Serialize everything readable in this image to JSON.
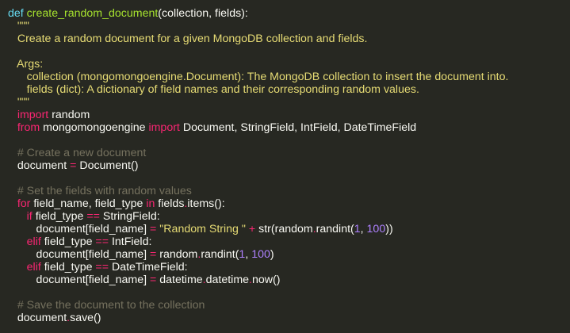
{
  "code": {
    "language": "python",
    "lines": [
      [
        [
          "kw",
          "def "
        ],
        [
          "fn",
          "create_random_document"
        ],
        [
          "tx",
          "(collection, fields):"
        ]
      ],
      [
        [
          "str",
          "   \"\"\""
        ]
      ],
      [
        [
          "str",
          "   Create a random document for a given MongoDB collection and fields."
        ]
      ],
      [],
      [
        [
          "str",
          "   Args:"
        ]
      ],
      [
        [
          "str",
          "      collection (mongomongoengine.Document): The MongoDB collection to insert the document into."
        ]
      ],
      [
        [
          "str",
          "      fields (dict): A dictionary of field names and their corresponding random values."
        ]
      ],
      [
        [
          "str",
          "   \"\"\""
        ]
      ],
      [
        [
          "op",
          "   import"
        ],
        [
          "tx",
          " random"
        ]
      ],
      [
        [
          "op",
          "   from"
        ],
        [
          "tx",
          " mongomongoengine "
        ],
        [
          "op",
          "import"
        ],
        [
          "tx",
          " Document, StringField, IntField, DateTimeField"
        ]
      ],
      [],
      [
        [
          "cm",
          "   # Create a new document"
        ]
      ],
      [
        [
          "tx",
          "   document "
        ],
        [
          "op",
          "="
        ],
        [
          "tx",
          " Document()"
        ]
      ],
      [],
      [
        [
          "cm",
          "   # Set the fields with random values"
        ]
      ],
      [
        [
          "op",
          "   for"
        ],
        [
          "tx",
          " field_name, field_type "
        ],
        [
          "op",
          "in"
        ],
        [
          "tx",
          " fields"
        ],
        [
          "op",
          "."
        ],
        [
          "tx",
          "items():"
        ]
      ],
      [
        [
          "op",
          "      if"
        ],
        [
          "tx",
          " field_type "
        ],
        [
          "op",
          "=="
        ],
        [
          "tx",
          " StringField:"
        ]
      ],
      [
        [
          "tx",
          "         document[field_name] "
        ],
        [
          "op",
          "="
        ],
        [
          "tx",
          " "
        ],
        [
          "str",
          "\"Random String \""
        ],
        [
          "tx",
          " "
        ],
        [
          "op",
          "+"
        ],
        [
          "tx",
          " str(random"
        ],
        [
          "op",
          "."
        ],
        [
          "tx",
          "randint("
        ],
        [
          "num",
          "1"
        ],
        [
          "tx",
          ", "
        ],
        [
          "num",
          "100"
        ],
        [
          "tx",
          "))"
        ]
      ],
      [
        [
          "op",
          "      elif"
        ],
        [
          "tx",
          " field_type "
        ],
        [
          "op",
          "=="
        ],
        [
          "tx",
          " IntField:"
        ]
      ],
      [
        [
          "tx",
          "         document[field_name] "
        ],
        [
          "op",
          "="
        ],
        [
          "tx",
          " random"
        ],
        [
          "op",
          "."
        ],
        [
          "tx",
          "randint("
        ],
        [
          "num",
          "1"
        ],
        [
          "tx",
          ", "
        ],
        [
          "num",
          "100"
        ],
        [
          "tx",
          ")"
        ]
      ],
      [
        [
          "op",
          "      elif"
        ],
        [
          "tx",
          " field_type "
        ],
        [
          "op",
          "=="
        ],
        [
          "tx",
          " DateTimeField:"
        ]
      ],
      [
        [
          "tx",
          "         document[field_name] "
        ],
        [
          "op",
          "="
        ],
        [
          "tx",
          " datetime"
        ],
        [
          "op",
          "."
        ],
        [
          "tx",
          "datetime"
        ],
        [
          "op",
          "."
        ],
        [
          "tx",
          "now()"
        ]
      ],
      [],
      [
        [
          "cm",
          "   # Save the document to the collection"
        ]
      ],
      [
        [
          "tx",
          "   document"
        ],
        [
          "op",
          "."
        ],
        [
          "tx",
          "save()"
        ]
      ]
    ]
  },
  "colors": {
    "background": "#272822",
    "default_text": "#f8f8f2",
    "keyword_def": "#66d9ef",
    "keyword": "#f92672",
    "function_name": "#a6e22e",
    "string": "#e6db74",
    "number": "#ae81ff",
    "comment": "#75715e"
  }
}
